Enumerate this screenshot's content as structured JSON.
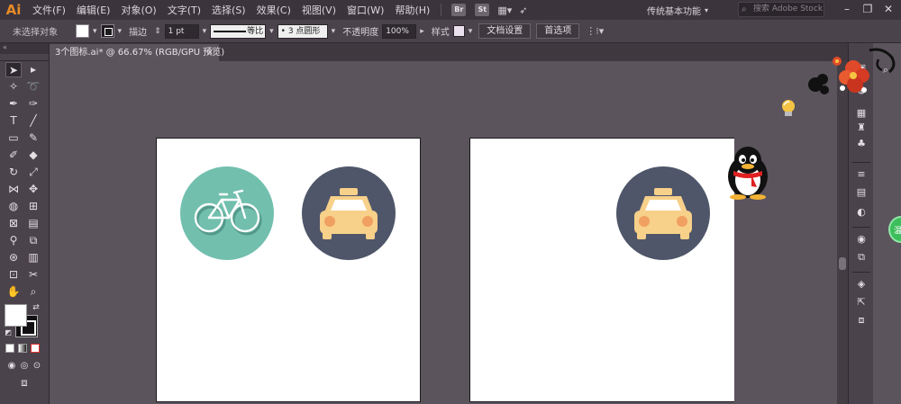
{
  "app": {
    "logo": "Ai",
    "menus": [
      "文件(F)",
      "编辑(E)",
      "对象(O)",
      "文字(T)",
      "选择(S)",
      "效果(C)",
      "视图(V)",
      "窗口(W)",
      "帮助(H)"
    ],
    "bridge_label": "Br",
    "stock_label": "St",
    "workspace": "传统基本功能",
    "search_placeholder": "搜索 Adobe Stock"
  },
  "control": {
    "selection_status": "未选择对象",
    "stroke_label": "描边",
    "stroke_weight": "1 pt",
    "stroke_style": "等比",
    "brush": "3 点圆形",
    "opacity_label": "不透明度",
    "opacity_value": "100%",
    "style_label": "样式",
    "doc_setup": "文档设置",
    "preferences": "首选项"
  },
  "document": {
    "tab_title": "3个图标.ai* @ 66.67% (RGB/GPU 预览)",
    "close": "×"
  },
  "overlay": {
    "green_badge": "温"
  },
  "colors": {
    "teal_circle": "#72bfae",
    "navy_circle": "#4f5669",
    "taxi_body": "#f7d08a",
    "taxi_light": "#f0a060"
  },
  "icons": [
    "bicycle-icon",
    "taxi-icon",
    "taxi-icon",
    "qq-penguin-icon",
    "lightbulb-icon"
  ]
}
